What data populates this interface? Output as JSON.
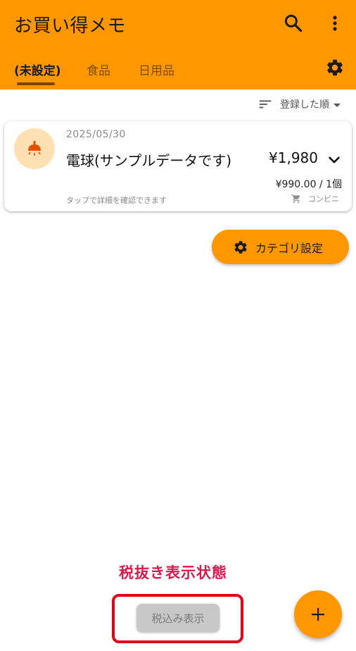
{
  "appbar": {
    "title": "お買い得メモ",
    "background_color": "#ff9800",
    "search_icon": "search-icon",
    "more_icon": "more-vert-icon",
    "settings_icon": "gear-icon"
  },
  "tabs": [
    {
      "label": "(未設定)",
      "active": true
    },
    {
      "label": "食品",
      "active": false
    },
    {
      "label": "日用品",
      "active": false
    }
  ],
  "sort": {
    "icon": "sort-icon",
    "label": "登録した順"
  },
  "items": [
    {
      "icon": "lamp-icon",
      "date": "2025/05/30",
      "name": "電球(サンプルデータです)",
      "price": "¥1,980",
      "unit_price": "¥990.00 / 1個",
      "hint": "タップで詳細を確認できます",
      "store": "コンビニ",
      "store_icon": "cart-icon"
    }
  ],
  "category_button": {
    "label": "カテゴリ設定",
    "icon": "gear-icon"
  },
  "annotation": {
    "label": "税抜き表示状態",
    "color": "#d81b4f",
    "box_color": "#e0001b"
  },
  "tax_toggle": {
    "label": "税込み表示"
  },
  "fab": {
    "icon": "plus-icon",
    "color": "#ff9800"
  }
}
